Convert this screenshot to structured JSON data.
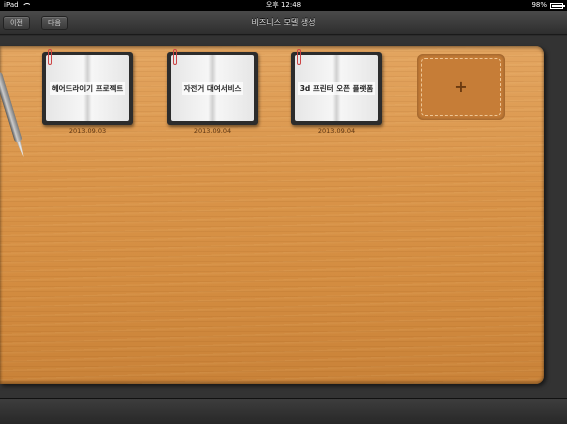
{
  "status_bar": {
    "device": "iPad",
    "time": "오후 12:48",
    "battery": "98%"
  },
  "nav": {
    "prev_label": "이전",
    "next_label": "다음",
    "title": "비즈니스 모델 생성"
  },
  "notebooks": [
    {
      "title": "헤어드라이기 프로젝트",
      "date": "2013.09.03"
    },
    {
      "title": "자전거 대여서비스",
      "date": "2013.09.04"
    },
    {
      "title": "3d 프린터 오픈 플랫폼",
      "date": "2013.09.04"
    }
  ],
  "add_button": {
    "icon": "+"
  },
  "colors": {
    "wood": "#d99449",
    "nav_bg": "#3a3a3a",
    "date_text": "#5a3412"
  }
}
